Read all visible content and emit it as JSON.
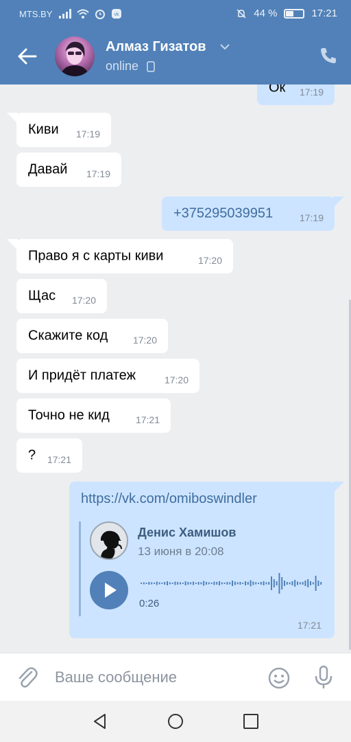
{
  "status_bar": {
    "carrier": "MTS.BY",
    "battery_percent": "44 %",
    "battery_level": 0.44,
    "time": "17:21"
  },
  "header": {
    "back_icon": "arrow-left-icon",
    "contact_name": "Алмаз Гизатов",
    "status": "online",
    "call_icon": "phone-icon"
  },
  "messages": [
    {
      "direction": "out",
      "text": "Ок",
      "time": "17:19"
    },
    {
      "direction": "in",
      "text": "Киви",
      "time": "17:19"
    },
    {
      "direction": "in",
      "text": "Давай",
      "time": "17:19"
    },
    {
      "direction": "out",
      "text": "+375295039951",
      "time": "17:19"
    },
    {
      "direction": "in",
      "text": "Право я с карты киви",
      "time": "17:20"
    },
    {
      "direction": "in",
      "text": "Щас",
      "time": "17:20"
    },
    {
      "direction": "in",
      "text": "Скажите код",
      "time": "17:20"
    },
    {
      "direction": "in",
      "text": "И придёт платеж",
      "time": "17:20"
    },
    {
      "direction": "in",
      "text": "Точно не кид",
      "time": "17:21"
    },
    {
      "direction": "in",
      "text": "?",
      "time": "17:21"
    }
  ],
  "shared_card": {
    "link": "https://vk.com/omiboswindler",
    "author": "Денис Хамишов",
    "date": "13 июня в 20:08",
    "duration": "0:26",
    "time": "17:21"
  },
  "input": {
    "placeholder": "Ваше сообщение",
    "value": ""
  },
  "colors": {
    "header": "#5181b8",
    "incoming_bubble": "#ffffff",
    "outgoing_bubble": "#cce4ff",
    "background": "#edeef0"
  }
}
